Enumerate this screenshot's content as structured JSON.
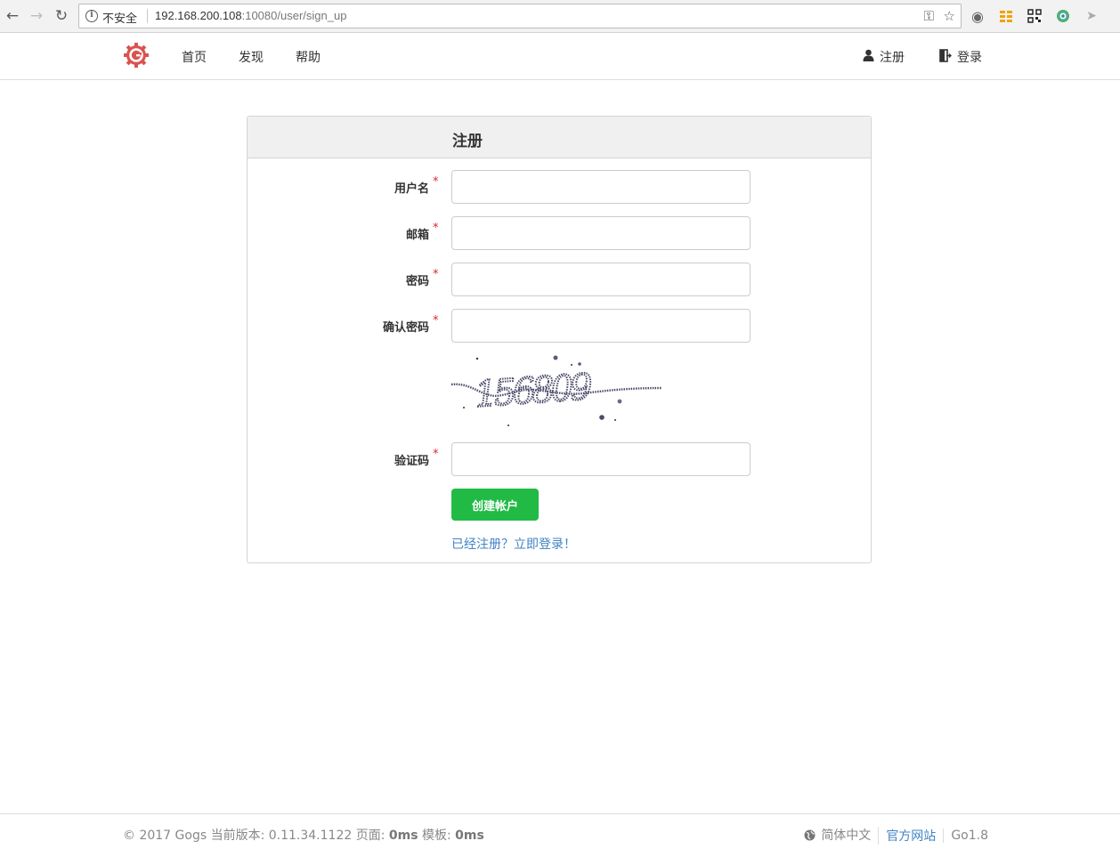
{
  "browser": {
    "back_icon": "arrow-left-icon",
    "forward_icon": "arrow-right-icon",
    "reload_icon": "reload-icon",
    "security_label": "不安全",
    "url_host": "192.168.200.108",
    "url_rest": ":10080/user/sign_up"
  },
  "header": {
    "nav": [
      "首页",
      "发现",
      "帮助"
    ],
    "register_label": "注册",
    "login_label": "登录"
  },
  "form": {
    "title": "注册",
    "fields": [
      {
        "label": "用户名",
        "required": "*",
        "value": ""
      },
      {
        "label": "邮箱",
        "required": "*",
        "value": ""
      },
      {
        "label": "密码",
        "required": "*",
        "value": ""
      },
      {
        "label": "确认密码",
        "required": "*",
        "value": ""
      },
      {
        "label": "验证码",
        "required": "*",
        "value": ""
      }
    ],
    "captcha_text": "156809",
    "submit_label": "创建帐户",
    "signin_link": "已经注册？立即登录！"
  },
  "footer": {
    "copyright": "© 2017 Gogs 当前版本: 0.11.34.1122 页面: ",
    "page_time": "0ms",
    "template_label": " 模板: ",
    "template_time": "0ms",
    "language": "简体中文",
    "official_site": "官方网站",
    "go_version": "Go1.8"
  },
  "colors": {
    "accent_green": "#21ba45",
    "link_blue": "#4183c4",
    "required_red": "#db2828",
    "logo_red": "#d9534f"
  }
}
